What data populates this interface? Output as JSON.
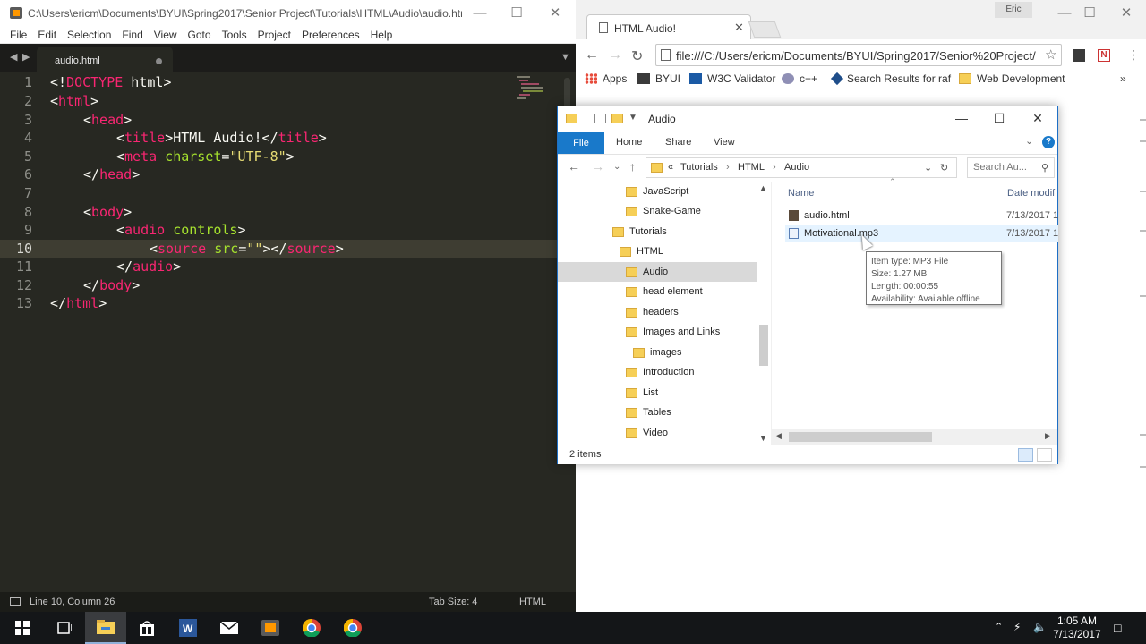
{
  "sublime": {
    "title": "C:\\Users\\ericm\\Documents\\BYUI\\Spring2017\\Senior Project\\Tutorials\\HTML\\Audio\\audio.htm...",
    "menu": [
      "File",
      "Edit",
      "Selection",
      "Find",
      "View",
      "Goto",
      "Tools",
      "Project",
      "Preferences",
      "Help"
    ],
    "tab_label": "audio.html",
    "line_numbers": [
      "1",
      "2",
      "3",
      "4",
      "5",
      "6",
      "7",
      "8",
      "9",
      "10",
      "11",
      "12",
      "13"
    ],
    "code": {
      "l1": {
        "p1": "<!",
        "kw": "DOCTYPE",
        "p2": " html>"
      },
      "l2": {
        "p1": "<",
        "tag": "html",
        "p2": ">"
      },
      "l3": {
        "p1": "<",
        "tag": "head",
        "p2": ">"
      },
      "l4": {
        "p1": "<",
        "tag": "title",
        "text": ">HTML Audio!</",
        "tag2": "title",
        "p2": ">"
      },
      "l5": {
        "p1": "<",
        "tag": "meta",
        "attr": " charset",
        "eq": "=",
        "val": "\"UTF-8\"",
        "p2": ">"
      },
      "l8": {
        "p1": "<",
        "tag": "body",
        "p2": ">"
      },
      "l9": {
        "p1": "<",
        "tag": "audio",
        "attr": " controls",
        "p2": ">"
      },
      "l10": {
        "p1": "<",
        "tag": "source",
        "attr": " src",
        "eq": "=",
        "val": "\"\"",
        "p2": "></",
        "tag2": "source",
        "p3": ">"
      },
      "l11": {
        "p1": "</",
        "tag": "audio",
        "p2": ">"
      },
      "l12": {
        "p1": "</",
        "tag": "body",
        "p2": ">"
      },
      "l13": {
        "p1": "</",
        "tag": "html",
        "p2": ">"
      }
    },
    "status": {
      "position": "Line 10, Column 26",
      "tab_size": "Tab Size: 4",
      "syntax": "HTML"
    }
  },
  "chrome": {
    "tab_title": "HTML Audio!",
    "url": "file:///C:/Users/ericm/Documents/BYUI/Spring2017/Senior%20Project/",
    "user": "Eric",
    "bookmarks": [
      "Apps",
      "BYUI",
      "W3C Validator",
      "c++",
      "Search Results for raf",
      "Web Development"
    ],
    "bookmarks_more": "»"
  },
  "explorer": {
    "title": "Audio",
    "ribbon_tabs": {
      "file": "File",
      "home": "Home",
      "share": "Share",
      "view": "View"
    },
    "crumbs": {
      "prefix": "«",
      "c1": "Tutorials",
      "c2": "HTML",
      "c3": "Audio",
      "sep": "›"
    },
    "search_placeholder": "Search Au...",
    "nav_items": [
      {
        "label": "JavaScript"
      },
      {
        "label": "Snake-Game"
      },
      {
        "label": "Tutorials"
      },
      {
        "label": "HTML"
      },
      {
        "label": "Audio"
      },
      {
        "label": "head element"
      },
      {
        "label": "headers"
      },
      {
        "label": "Images and Links"
      },
      {
        "label": "images"
      },
      {
        "label": "Introduction"
      },
      {
        "label": "List"
      },
      {
        "label": "Tables"
      },
      {
        "label": "Video"
      }
    ],
    "columns": {
      "name": "Name",
      "date": "Date modif"
    },
    "files": [
      {
        "name": "audio.html",
        "date": "7/13/2017 1"
      },
      {
        "name": "Motivational.mp3",
        "date": "7/13/2017 1"
      }
    ],
    "tooltip": {
      "type": "Item type: MP3 File",
      "size": "Size: 1.27 MB",
      "length": "Length: 00:00:55",
      "availability": "Availability: Available offline"
    },
    "status": "2 items"
  },
  "taskbar": {
    "time": "1:05 AM",
    "date": "7/13/2017"
  }
}
